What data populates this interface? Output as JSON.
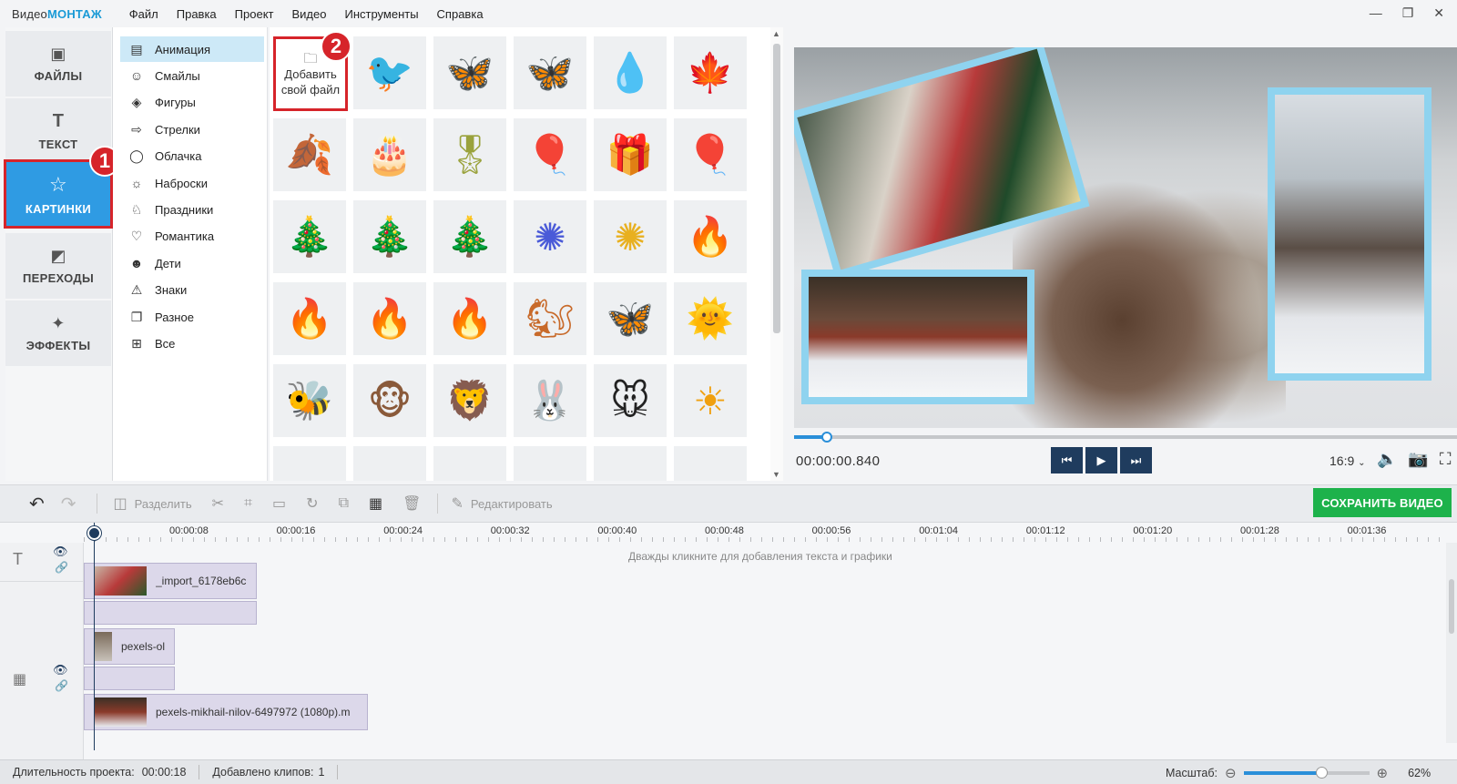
{
  "app": {
    "logo_part1": "Видео",
    "logo_part2": "МОНТАЖ"
  },
  "menu": [
    "Файл",
    "Правка",
    "Проект",
    "Видео",
    "Инструменты",
    "Справка"
  ],
  "window_controls": {
    "minimize": "—",
    "maximize": "❐",
    "close": "✕"
  },
  "tabs": [
    {
      "label": "ФАЙЛЫ",
      "icon": "image-icon",
      "glyph": "▣"
    },
    {
      "label": "ТЕКСТ",
      "icon": "text-icon",
      "glyph": "T"
    },
    {
      "label": "КАРТИНКИ",
      "icon": "star-icon",
      "glyph": "☆",
      "active": true
    },
    {
      "label": "ПЕРЕХОДЫ",
      "icon": "transitions-icon",
      "glyph": "◩"
    },
    {
      "label": "ЭФФЕКТЫ",
      "icon": "magic-wand-icon",
      "glyph": "✦"
    }
  ],
  "badges": {
    "first": "1",
    "second": "2"
  },
  "categories": [
    {
      "label": "Анимация",
      "icon": "film-icon",
      "glyph": "▤",
      "active": true
    },
    {
      "label": "Смайлы",
      "icon": "smile-icon",
      "glyph": "☺"
    },
    {
      "label": "Фигуры",
      "icon": "shapes-icon",
      "glyph": "◈"
    },
    {
      "label": "Стрелки",
      "icon": "arrow-icon",
      "glyph": "⇨"
    },
    {
      "label": "Облачка",
      "icon": "speech-bubble-icon",
      "glyph": "◯"
    },
    {
      "label": "Наброски",
      "icon": "sketch-icon",
      "glyph": "☼"
    },
    {
      "label": "Праздники",
      "icon": "holiday-icon",
      "glyph": "♘"
    },
    {
      "label": "Романтика",
      "icon": "heart-icon",
      "glyph": "♡"
    },
    {
      "label": "Дети",
      "icon": "kids-icon",
      "glyph": "☻"
    },
    {
      "label": "Знаки",
      "icon": "warning-icon",
      "glyph": "⚠"
    },
    {
      "label": "Разное",
      "icon": "misc-icon",
      "glyph": "❐"
    },
    {
      "label": "Все",
      "icon": "grid-icon",
      "glyph": "⊞"
    }
  ],
  "add_file": {
    "label_line1": "Добавить",
    "label_line2": "свой файл",
    "icon": "folder-icon"
  },
  "gallery": [
    {
      "icon": "swallow-icon",
      "glyph": "🐦",
      "color": "#2b4a6b"
    },
    {
      "icon": "butterfly-cyan-icon",
      "glyph": "🦋",
      "color": "#22c6d4"
    },
    {
      "icon": "butterfly-blue-icon",
      "glyph": "🦋",
      "color": "#2a4fa8"
    },
    {
      "icon": "drops-icon",
      "glyph": "💧",
      "color": "#8b8be0"
    },
    {
      "icon": "maple-leaf-icon",
      "glyph": "🍁",
      "color": "#e0641e"
    },
    {
      "icon": "autumn-leaves-icon",
      "glyph": "🍂",
      "color": "#d88220"
    },
    {
      "icon": "cake-icon",
      "glyph": "🎂",
      "color": "#e04a7a"
    },
    {
      "icon": "banner-icon",
      "glyph": "🎖",
      "color": "#9aa23c"
    },
    {
      "icon": "balloons-gold-icon",
      "glyph": "🎈",
      "color": "#c9a543"
    },
    {
      "icon": "gift-icon",
      "glyph": "🎁",
      "color": "#1a8a8a"
    },
    {
      "icon": "balloons-red-icon",
      "glyph": "🎈",
      "color": "#c8412a"
    },
    {
      "icon": "xmas-tree-lights-icon",
      "glyph": "🎄",
      "color": "#2f7a2f"
    },
    {
      "icon": "xmas-tree-icon",
      "glyph": "🎄",
      "color": "#1f6a2a"
    },
    {
      "icon": "xmas-tree-snow-icon",
      "glyph": "🎄",
      "color": "#3a8a4a"
    },
    {
      "icon": "firework-blue-icon",
      "glyph": "✺",
      "color": "#4a5ad8"
    },
    {
      "icon": "firework-color-icon",
      "glyph": "✺",
      "color": "#e8b020"
    },
    {
      "icon": "flame-thin-icon",
      "glyph": "🔥",
      "color": "#e88020"
    },
    {
      "icon": "fire-small-icon",
      "glyph": "🔥",
      "color": "#f0a020"
    },
    {
      "icon": "fire-big-icon",
      "glyph": "🔥",
      "color": "#e83a10"
    },
    {
      "icon": "fire-row-icon",
      "glyph": "🔥",
      "color": "#e86020"
    },
    {
      "icon": "squirrel-icon",
      "glyph": "🐿",
      "color": "#c86a2a"
    },
    {
      "icon": "butterfly-pink-icon",
      "glyph": "🦋",
      "color": "#a07ad8"
    },
    {
      "icon": "sun-face-icon",
      "glyph": "🌞",
      "color": "#f0b820"
    },
    {
      "icon": "bee-kid-icon",
      "glyph": "🐝",
      "color": "#e8a030"
    },
    {
      "icon": "monkey-icon",
      "glyph": "🐵",
      "color": "#8a5a3a"
    },
    {
      "icon": "lion-icon",
      "glyph": "🦁",
      "color": "#d8902a"
    },
    {
      "icon": "bunny-icon",
      "glyph": "🐰",
      "color": "#b8a8c8"
    },
    {
      "icon": "mickey-icon",
      "glyph": "🐭",
      "color": "#222222"
    },
    {
      "icon": "sun-icon",
      "glyph": "☀",
      "color": "#f0a010"
    }
  ],
  "preview": {
    "timecode": "00:00:00.840",
    "progress": 0.05,
    "ratio": "16:9",
    "transport": {
      "prev": "⏮",
      "play": "▶",
      "next": "⏭"
    },
    "icons": {
      "volume": "🔈",
      "snapshot": "📷",
      "fullscreen": "⛶"
    }
  },
  "toolbar": {
    "undo": "↶",
    "redo": "↷",
    "split_label": "Разделить",
    "edit_label": "Редактировать",
    "save_label": "СОХРАНИТЬ ВИДЕО"
  },
  "timeline": {
    "ticks": [
      "00:00:08",
      "00:00:16",
      "00:00:24",
      "00:00:32",
      "00:00:40",
      "00:00:48",
      "00:00:56",
      "00:01:04",
      "00:01:12",
      "00:01:20",
      "00:01:28",
      "00:01:36"
    ],
    "hint": "Дважды кликните для добавления текста и графики",
    "clips": {
      "clip1": "_import_6178eb6c",
      "clip2": "pexels-ol",
      "clip3": "pexels-mikhail-nilov-6497972 (1080p).m"
    }
  },
  "status": {
    "duration_label": "Длительность проекта:",
    "duration_value": "00:00:18",
    "clips_label": "Добавлено клипов:",
    "clips_value": "1",
    "zoom_label": "Масштаб:",
    "zoom_value": "62%",
    "zoom_level": 0.62
  },
  "colors": {
    "accent": "#2f9be3",
    "highlight": "#d6242a",
    "save": "#1db24b",
    "navy": "#1f3c5e"
  }
}
